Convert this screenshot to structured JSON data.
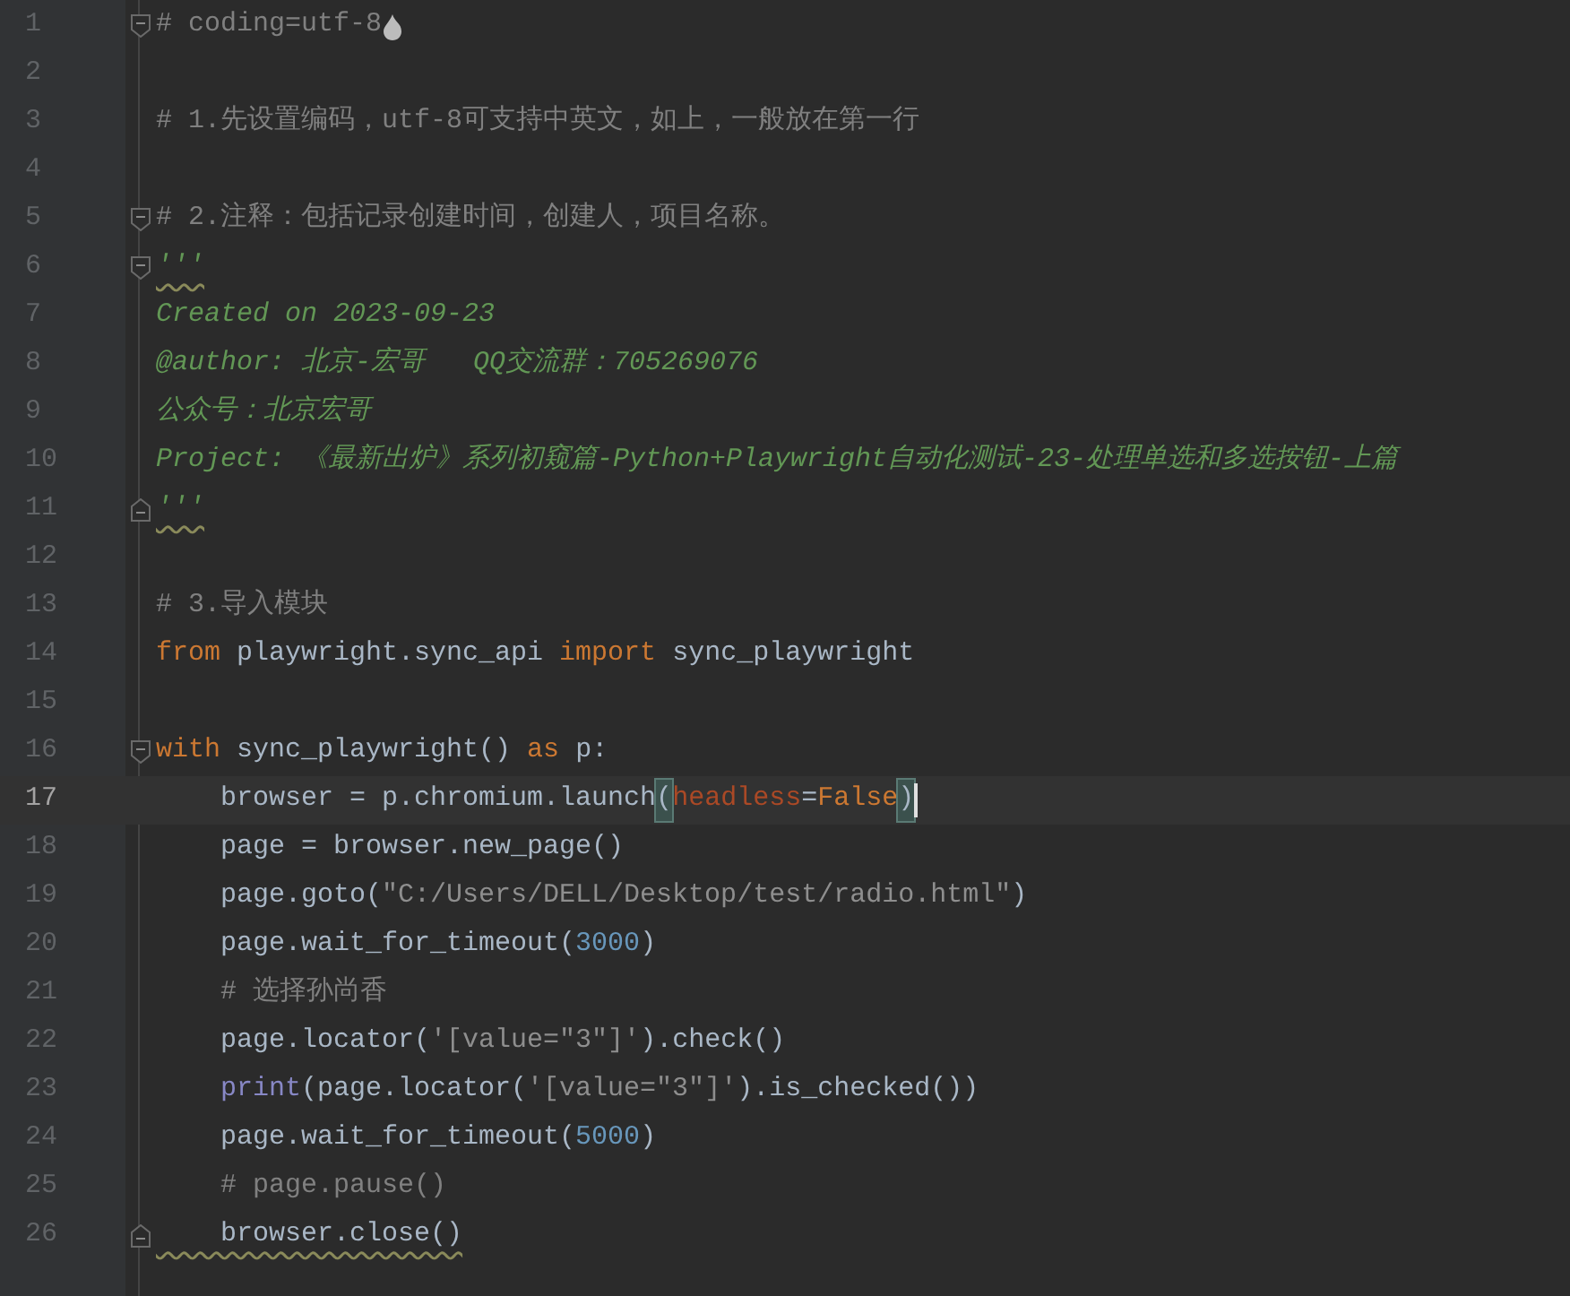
{
  "editor": {
    "lines": [
      {
        "number": "1",
        "fold_start": true,
        "hint": true,
        "tokens": [
          {
            "kind": "comment",
            "text": "# coding=utf-8"
          }
        ]
      },
      {
        "number": "2"
      },
      {
        "number": "3",
        "tokens": [
          {
            "kind": "comment",
            "text": "# 1.先设置编码，utf-8可支持中英文，如上，一般放在第一行"
          }
        ]
      },
      {
        "number": "4"
      },
      {
        "number": "5",
        "fold_start": true,
        "tokens": [
          {
            "kind": "comment",
            "text": "# 2.注释：包括记录创建时间，创建人，项目名称。"
          }
        ]
      },
      {
        "number": "6",
        "fold_start": true,
        "tokens": [
          {
            "kind": "docstring",
            "text": "'''",
            "underline": true
          }
        ]
      },
      {
        "number": "7",
        "tokens": [
          {
            "kind": "docstring",
            "text": "Created on 2023-09-23"
          }
        ]
      },
      {
        "number": "8",
        "tokens": [
          {
            "kind": "docstring",
            "text": "@author: 北京-宏哥   QQ交流群：705269076"
          }
        ]
      },
      {
        "number": "9",
        "tokens": [
          {
            "kind": "docstring",
            "text": "公众号：北京宏哥"
          }
        ]
      },
      {
        "number": "10",
        "tokens": [
          {
            "kind": "docstring",
            "text": "Project: 《最新出炉》系列初窥篇-Python+Playwright自动化测试-23-处理单选和多选按钮-上篇"
          }
        ]
      },
      {
        "number": "11",
        "fold_end": true,
        "tokens": [
          {
            "kind": "docstring",
            "text": "'''",
            "underline": true
          }
        ]
      },
      {
        "number": "12"
      },
      {
        "number": "13",
        "tokens": [
          {
            "kind": "comment",
            "text": "# 3.导入模块"
          }
        ]
      },
      {
        "number": "14",
        "tokens": [
          {
            "kind": "keyword",
            "text": "from"
          },
          {
            "kind": "plain",
            "text": " playwright.sync_api "
          },
          {
            "kind": "keyword",
            "text": "import"
          },
          {
            "kind": "plain",
            "text": " sync_playwright"
          }
        ]
      },
      {
        "number": "15"
      },
      {
        "number": "16",
        "fold_start": true,
        "tokens": [
          {
            "kind": "keyword",
            "text": "with"
          },
          {
            "kind": "plain",
            "text": " sync_playwright() "
          },
          {
            "kind": "keyword",
            "text": "as"
          },
          {
            "kind": "plain",
            "text": " p:"
          }
        ]
      },
      {
        "number": "17",
        "current": true,
        "tokens": [
          {
            "kind": "plain",
            "text": "    browser = p.chromium.launch"
          },
          {
            "kind": "plain",
            "text": "(",
            "match": true
          },
          {
            "kind": "param",
            "text": "headless"
          },
          {
            "kind": "plain",
            "text": "="
          },
          {
            "kind": "keyword",
            "text": "False"
          },
          {
            "kind": "plain",
            "text": ")",
            "match": true
          }
        ]
      },
      {
        "number": "18",
        "tokens": [
          {
            "kind": "plain",
            "text": "    page = browser.new_page()"
          }
        ]
      },
      {
        "number": "19",
        "tokens": [
          {
            "kind": "plain",
            "text": "    page.goto("
          },
          {
            "kind": "string",
            "text": "\"C:/Users/DELL/Desktop/test/radio.html\""
          },
          {
            "kind": "plain",
            "text": ")"
          }
        ]
      },
      {
        "number": "20",
        "tokens": [
          {
            "kind": "plain",
            "text": "    page.wait_for_timeout("
          },
          {
            "kind": "number",
            "text": "3000"
          },
          {
            "kind": "plain",
            "text": ")"
          }
        ]
      },
      {
        "number": "21",
        "tokens": [
          {
            "kind": "comment",
            "text": "    # 选择孙尚香"
          }
        ]
      },
      {
        "number": "22",
        "tokens": [
          {
            "kind": "plain",
            "text": "    page.locator("
          },
          {
            "kind": "string",
            "text": "'[value=\"3\"]'"
          },
          {
            "kind": "plain",
            "text": ").check()"
          }
        ]
      },
      {
        "number": "23",
        "tokens": [
          {
            "kind": "builtin",
            "text": "    print"
          },
          {
            "kind": "plain",
            "text": "(page.locator("
          },
          {
            "kind": "string",
            "text": "'[value=\"3\"]'"
          },
          {
            "kind": "plain",
            "text": ").is_checked())"
          }
        ]
      },
      {
        "number": "24",
        "tokens": [
          {
            "kind": "plain",
            "text": "    page.wait_for_timeout("
          },
          {
            "kind": "number",
            "text": "5000"
          },
          {
            "kind": "plain",
            "text": ")"
          }
        ]
      },
      {
        "number": "25",
        "tokens": [
          {
            "kind": "comment",
            "text": "    # page.pause()"
          }
        ]
      },
      {
        "number": "26",
        "fold_end": true,
        "tokens": [
          {
            "kind": "plain",
            "text": "    browser.close()",
            "underline": true
          }
        ]
      }
    ]
  }
}
